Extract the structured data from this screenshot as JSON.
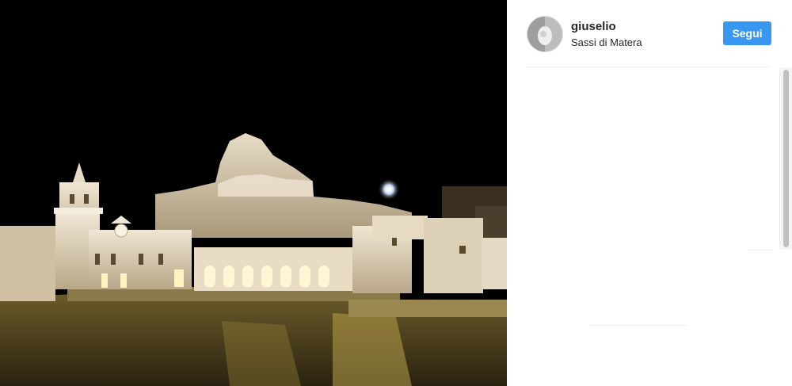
{
  "post": {
    "username": "giuselio",
    "location": "Sassi di Matera",
    "follow_label": "Segui"
  },
  "colors": {
    "accent": "#3897f0",
    "text": "#262626"
  },
  "icons": {
    "avatar": "profile-photo",
    "photo": "night-photo-sassi-di-matera"
  }
}
